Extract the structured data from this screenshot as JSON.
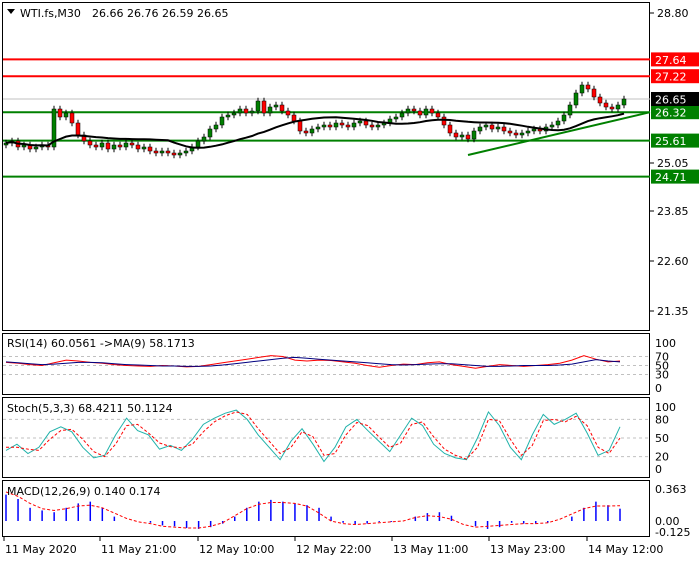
{
  "header": {
    "symbol": "WTI.fs,M30",
    "ohlc": "26.66 26.76 26.59 26.65"
  },
  "colors": {
    "up": "#008000",
    "down": "#ff0000",
    "support": "#008000",
    "resistance": "#ff0000",
    "ma": "#000000",
    "bid": "#c0c0c0"
  },
  "price_axis": {
    "ticks": [
      "28.80",
      "25.05",
      "23.85",
      "22.60",
      "21.35"
    ],
    "tick_values": [
      28.8,
      25.05,
      23.85,
      22.6,
      21.35
    ]
  },
  "levels": [
    {
      "value": 27.64,
      "label": "27.64",
      "type": "resistance"
    },
    {
      "value": 27.22,
      "label": "27.22",
      "type": "resistance"
    },
    {
      "value": 26.32,
      "label": "26.32",
      "type": "support"
    },
    {
      "value": 25.61,
      "label": "25.61",
      "type": "support"
    },
    {
      "value": 24.71,
      "label": "24.71",
      "type": "support"
    }
  ],
  "bid": {
    "value": 26.65,
    "label": "26.65"
  },
  "trendline": {
    "start_index": 77,
    "start_price": 25.25,
    "end_index": 107,
    "end_price": 26.32
  },
  "time_axis": [
    "11 May 2020",
    "11 May 21:00",
    "12 May 10:00",
    "12 May 22:00",
    "13 May 11:00",
    "13 May 23:00",
    "14 May 12:00"
  ],
  "chart_data": [
    {
      "type": "candlestick",
      "title": "WTI.fs,M30",
      "ylim": [
        21.0,
        29.0
      ],
      "ma_period": 20,
      "closes": [
        25.55,
        25.6,
        25.45,
        25.5,
        25.4,
        25.45,
        25.5,
        25.45,
        26.4,
        26.2,
        26.3,
        26.05,
        25.75,
        25.6,
        25.5,
        25.45,
        25.55,
        25.4,
        25.5,
        25.45,
        25.55,
        25.5,
        25.4,
        25.45,
        25.35,
        25.3,
        25.35,
        25.3,
        25.25,
        25.3,
        25.35,
        25.45,
        25.6,
        25.7,
        25.9,
        26.0,
        26.2,
        26.25,
        26.3,
        26.4,
        26.3,
        26.35,
        26.6,
        26.3,
        26.45,
        26.5,
        26.35,
        26.25,
        26.1,
        25.85,
        25.8,
        25.9,
        25.95,
        26.0,
        25.95,
        26.05,
        26.0,
        25.95,
        26.05,
        26.1,
        26.0,
        25.95,
        26.0,
        26.05,
        26.15,
        26.2,
        26.3,
        26.4,
        26.35,
        26.25,
        26.4,
        26.3,
        26.2,
        26.0,
        25.8,
        25.7,
        25.75,
        25.65,
        25.85,
        25.95,
        26.0,
        25.9,
        25.95,
        25.85,
        25.8,
        25.75,
        25.8,
        25.85,
        25.9,
        25.85,
        25.95,
        26.0,
        26.1,
        26.25,
        26.5,
        26.8,
        27.0,
        26.9,
        26.7,
        26.55,
        26.45,
        26.4,
        26.5,
        26.65
      ]
    },
    {
      "type": "line",
      "title": "RSI(14) 60.0561  ->MA(9) 58.1713",
      "ticks": [
        "100",
        "70",
        "50",
        "30",
        "0"
      ],
      "tick_values": [
        100,
        70,
        50,
        30,
        0
      ],
      "levels": [
        70,
        50,
        30
      ],
      "ylim": [
        0,
        100
      ],
      "series": [
        {
          "name": "RSI",
          "color": "#ff0000",
          "values": [
            57,
            55,
            52,
            50,
            56,
            62,
            60,
            57,
            55,
            52,
            50,
            49,
            48,
            50,
            49,
            47,
            48,
            52,
            56,
            60,
            64,
            68,
            72,
            70,
            62,
            60,
            62,
            61,
            58,
            55,
            50,
            46,
            50,
            53,
            52,
            56,
            58,
            52,
            48,
            44,
            48,
            52,
            50,
            48,
            50,
            52,
            55,
            62,
            72,
            64,
            58,
            60
          ]
        },
        {
          "name": "MA",
          "color": "#000080",
          "values": [
            58,
            56,
            54,
            52,
            53,
            55,
            57,
            57,
            56,
            54,
            52,
            51,
            50,
            49,
            49,
            48,
            48,
            49,
            51,
            54,
            57,
            60,
            63,
            66,
            68,
            66,
            64,
            62,
            60,
            58,
            56,
            54,
            52,
            51,
            52,
            53,
            54,
            54,
            52,
            50,
            48,
            48,
            49,
            50,
            50,
            50,
            51,
            53,
            58,
            63,
            60,
            58
          ]
        }
      ]
    },
    {
      "type": "line",
      "title": "Stoch(5,3,3) 68.4211 50.1124",
      "ticks": [
        "100",
        "80",
        "50",
        "20",
        "0"
      ],
      "tick_values": [
        100,
        80,
        50,
        20,
        0
      ],
      "levels": [
        80,
        50,
        20
      ],
      "ylim": [
        0,
        100
      ],
      "series": [
        {
          "name": "Main",
          "color": "#20b2aa",
          "values": [
            30,
            40,
            25,
            35,
            60,
            68,
            60,
            35,
            18,
            22,
            55,
            82,
            62,
            55,
            32,
            38,
            30,
            48,
            72,
            82,
            90,
            95,
            80,
            55,
            35,
            15,
            45,
            65,
            40,
            12,
            35,
            68,
            80,
            62,
            45,
            28,
            55,
            82,
            70,
            40,
            25,
            18,
            15,
            50,
            92,
            70,
            35,
            15,
            55,
            88,
            72,
            80,
            90,
            58,
            22,
            30,
            68
          ]
        },
        {
          "name": "Signal",
          "color": "#ff0000",
          "values": [
            35,
            35,
            32,
            30,
            48,
            62,
            64,
            48,
            28,
            20,
            40,
            70,
            72,
            58,
            42,
            36,
            34,
            40,
            60,
            76,
            86,
            92,
            88,
            65,
            45,
            25,
            35,
            60,
            52,
            22,
            25,
            55,
            75,
            70,
            52,
            35,
            42,
            72,
            76,
            52,
            32,
            22,
            16,
            35,
            80,
            78,
            48,
            22,
            38,
            78,
            80,
            76,
            85,
            70,
            35,
            25,
            50
          ]
        }
      ]
    },
    {
      "type": "bar",
      "title": "MACD(12,26,9) 0.140 0.174",
      "ticks": [
        "0.363",
        "0.00",
        "-0.125"
      ],
      "tick_values": [
        0.363,
        0.0,
        -0.125
      ],
      "ylim": [
        -0.14,
        0.38
      ],
      "series": [
        {
          "name": "MACD",
          "color": "#0000ff",
          "values": [
            0.3,
            0.25,
            0.15,
            0.12,
            0.1,
            0.15,
            0.2,
            0.22,
            0.15,
            0.05,
            0.0,
            0.0,
            -0.02,
            -0.05,
            -0.06,
            -0.08,
            -0.09,
            -0.07,
            -0.03,
            0.05,
            0.15,
            0.22,
            0.24,
            0.22,
            0.2,
            0.18,
            0.15,
            0.05,
            -0.02,
            -0.04,
            -0.03,
            -0.01,
            -0.01,
            0.0,
            0.05,
            0.09,
            0.1,
            0.06,
            0.0,
            -0.06,
            -0.09,
            -0.07,
            -0.02,
            -0.03,
            -0.03,
            -0.02,
            0.0,
            0.05,
            0.15,
            0.22,
            0.18,
            0.14
          ]
        },
        {
          "name": "Signal",
          "color": "#ff0000",
          "values": [
            0.33,
            0.28,
            0.2,
            0.14,
            0.12,
            0.14,
            0.17,
            0.18,
            0.15,
            0.09,
            0.03,
            -0.01,
            -0.03,
            -0.06,
            -0.07,
            -0.08,
            -0.08,
            -0.06,
            -0.02,
            0.06,
            0.14,
            0.19,
            0.21,
            0.21,
            0.2,
            0.17,
            0.09,
            0.0,
            -0.03,
            -0.04,
            -0.03,
            -0.02,
            -0.01,
            0.0,
            0.04,
            0.06,
            0.05,
            0.02,
            -0.04,
            -0.07,
            -0.06,
            -0.05,
            -0.04,
            -0.03,
            -0.03,
            -0.02,
            0.02,
            0.08,
            0.14,
            0.17,
            0.17,
            0.174
          ]
        }
      ]
    }
  ]
}
